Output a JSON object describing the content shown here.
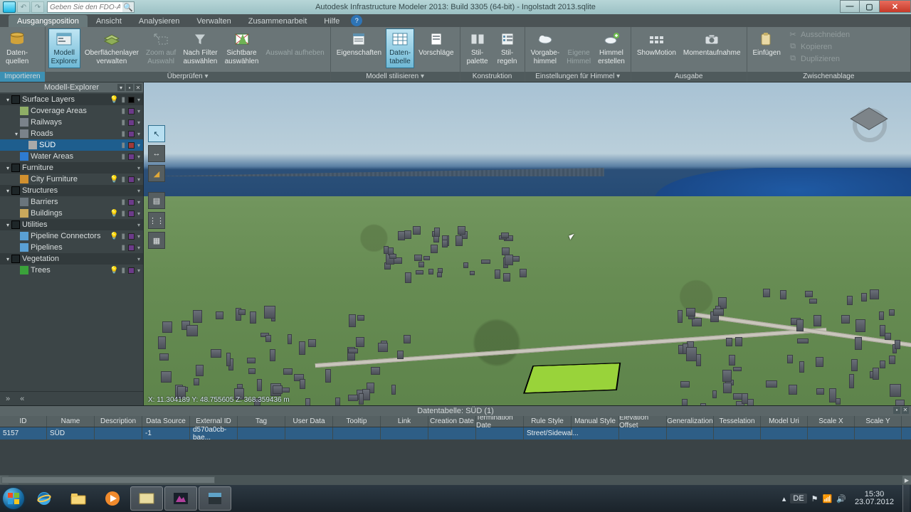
{
  "title": "Autodesk Infrastructure Modeler 2013: Build 3305 (64-bit)  -  Ingolstadt 2013.sqlite",
  "search": {
    "placeholder": "Geben Sie den FDO-Ausdru"
  },
  "tabs": [
    "Ausgangsposition",
    "Ansicht",
    "Analysieren",
    "Verwalten",
    "Zusammenarbeit",
    "Hilfe"
  ],
  "ribbon": {
    "import": {
      "cap": "Importieren",
      "btns": [
        {
          "id": "datenquellen",
          "tx": "Daten-\nquellen"
        }
      ]
    },
    "review": {
      "cap": "Überprüfen",
      "btns": [
        {
          "id": "modell-explorer",
          "tx": "Modell\nExplorer",
          "sel": true
        },
        {
          "id": "oberflaechenlayer",
          "tx": "Oberflächenlayer\nverwalten"
        },
        {
          "id": "zoom-auswahl",
          "tx": "Zoom auf\nAuswahl",
          "dis": true
        },
        {
          "id": "nach-filter",
          "tx": "Nach Filter\nauswählen"
        },
        {
          "id": "sichtbare",
          "tx": "Sichtbare\nauswählen"
        },
        {
          "id": "auswahl-aufheben",
          "tx": "Auswahl aufheben",
          "dis": true
        }
      ]
    },
    "stylize": {
      "cap": "Modell stilisieren",
      "btns": [
        {
          "id": "eigenschaften",
          "tx": "Eigenschaften"
        },
        {
          "id": "datentabelle",
          "tx": "Daten-\ntabelle",
          "sel": true
        },
        {
          "id": "vorschlaege",
          "tx": "Vorschläge"
        }
      ]
    },
    "konstruktion": {
      "cap": "Konstruktion",
      "btns": [
        {
          "id": "stilpalette",
          "tx": "Stil-\npalette"
        },
        {
          "id": "stilregeln",
          "tx": "Stil-\nregeln"
        }
      ]
    },
    "himmel": {
      "cap": "Einstellungen für Himmel",
      "btns": [
        {
          "id": "vorgabe-himmel",
          "tx": "Vorgabe-\nhimmel"
        },
        {
          "id": "eigene-himmel",
          "tx": "Eigene\nHimmel",
          "dis": true
        },
        {
          "id": "himmel-erstellen",
          "tx": "Himmel\nerstellen"
        }
      ]
    },
    "ausgabe": {
      "cap": "Ausgabe",
      "btns": [
        {
          "id": "showmotion",
          "tx": "ShowMotion"
        },
        {
          "id": "momentaufnahme",
          "tx": "Momentaufnahme"
        }
      ]
    },
    "zwischen": {
      "cap": "Zwischenablage",
      "btns": [
        {
          "id": "einfuegen",
          "tx": "Einfügen"
        }
      ],
      "side": [
        {
          "ic": "✂",
          "tx": "Ausschneiden"
        },
        {
          "ic": "⧉",
          "tx": "Kopieren"
        },
        {
          "ic": "⧉",
          "tx": "Duplizieren"
        }
      ]
    }
  },
  "explorer": {
    "title": "Modell-Explorer",
    "tree": [
      {
        "d": 0,
        "group": true,
        "name": "Surface Layers",
        "exp": "▾",
        "bulb": true,
        "sw": "#000"
      },
      {
        "d": 1,
        "name": "Coverage Areas",
        "ic": "#8fae66",
        "sw": "#6c3b8a"
      },
      {
        "d": 1,
        "name": "Railways",
        "ic": "#7a828a",
        "sw": "#6c3b8a"
      },
      {
        "d": 1,
        "name": "Roads",
        "exp": "▾",
        "ic": "#7a828a",
        "sw": "#6c3b8a"
      },
      {
        "d": 2,
        "name": "SÜD",
        "sel": true,
        "ic": "#a9a9a9",
        "sw": "#a03a3a"
      },
      {
        "d": 1,
        "name": "Water Areas",
        "ic": "#2e7bd1",
        "sw": "#6c3b8a"
      },
      {
        "d": 0,
        "group": true,
        "name": "Furniture",
        "exp": "▾"
      },
      {
        "d": 1,
        "name": "City Furniture",
        "ic": "#d1902f",
        "bulb": true,
        "sw": "#6c3b8a"
      },
      {
        "d": 0,
        "group": true,
        "name": "Structures",
        "exp": "▾"
      },
      {
        "d": 1,
        "name": "Barriers",
        "ic": "#6a757c",
        "sw": "#6c3b8a"
      },
      {
        "d": 1,
        "name": "Buildings",
        "ic": "#caa95c",
        "bulb": true,
        "sw": "#6c3b8a"
      },
      {
        "d": 0,
        "group": true,
        "name": "Utilities",
        "exp": "▾"
      },
      {
        "d": 1,
        "name": "Pipeline Connectors",
        "ic": "#5aa0d4",
        "bulb": true,
        "sw": "#6c3b8a"
      },
      {
        "d": 1,
        "name": "Pipelines",
        "ic": "#5aa0d4",
        "sw": "#6c3b8a"
      },
      {
        "d": 0,
        "group": true,
        "name": "Vegetation",
        "exp": "▾"
      },
      {
        "d": 1,
        "name": "Trees",
        "ic": "#3aa23a",
        "bulb": true,
        "sw": "#6c3b8a"
      }
    ]
  },
  "viewport": {
    "coords": "X: 11.304189  Y: 48.755605  Z: 368.359436  m"
  },
  "datatable": {
    "title": "Datentabelle: SÜD (1)",
    "cols": [
      "ID",
      "Name",
      "Description",
      "Data Source",
      "External ID",
      "Tag",
      "User Data",
      "Tooltip",
      "Link",
      "Creation Date",
      "Termination Date",
      "Rule Style",
      "Manual Style",
      "Elevation Offset",
      "Generalization",
      "Tesselation",
      "Model Uri",
      "Scale X",
      "Scale Y"
    ],
    "row": {
      "ID": "5157",
      "Name": "SÜD",
      "Data Source": "-1",
      "External ID": "d570a0cb-bae...",
      "Rule Style": "Street/Sidewal..."
    }
  },
  "taskbar": {
    "lang": "DE",
    "time": "15:30",
    "date": "23.07.2012"
  }
}
